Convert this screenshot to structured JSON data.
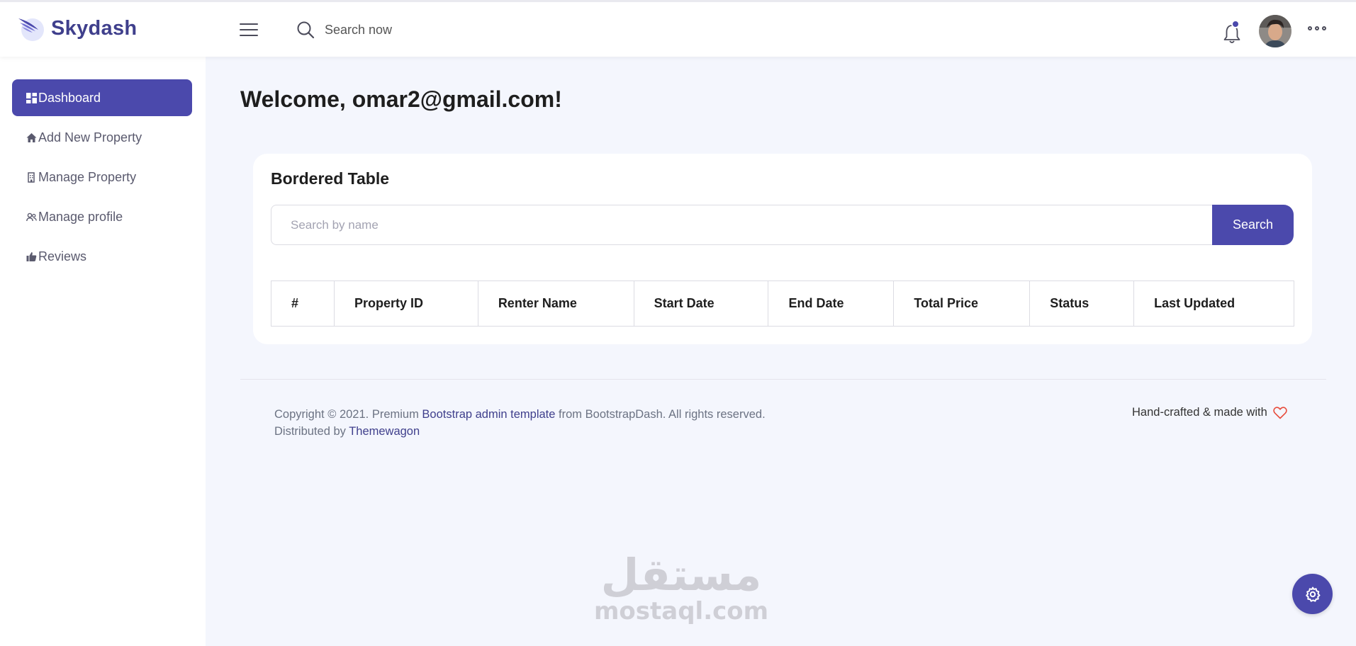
{
  "brand": {
    "name": "Skydash"
  },
  "header": {
    "search_placeholder": "Search now",
    "icons": [
      "menu-icon",
      "search-icon",
      "bell-icon",
      "avatar",
      "more-icon"
    ],
    "notification_dot_color": "#4b49ac"
  },
  "sidebar": {
    "items": [
      {
        "label": "Dashboard",
        "icon": "dashboard-icon",
        "active": true
      },
      {
        "label": "Add New Property",
        "icon": "home-icon",
        "active": false
      },
      {
        "label": "Manage Property",
        "icon": "building-icon",
        "active": false
      },
      {
        "label": "Manage profile",
        "icon": "users-icon",
        "active": false
      },
      {
        "label": "Reviews",
        "icon": "thumbs-up-icon",
        "active": false
      }
    ]
  },
  "main": {
    "welcome": "Welcome, omar2@gmail.com!",
    "card": {
      "title": "Bordered Table",
      "search_placeholder": "Search by name",
      "search_button": "Search",
      "columns": [
        "#",
        "Property ID",
        "Renter Name",
        "Start Date",
        "End Date",
        "Total Price",
        "Status",
        "Last Updated"
      ]
    }
  },
  "footer": {
    "copyright_prefix": "Copyright © 2021. Premium",
    "template_link": "Bootstrap admin template",
    "copyright_suffix": "from BootstrapDash. All rights reserved.",
    "distributed_prefix": "Distributed by",
    "distributed_link": "Themewagon",
    "crafted": "Hand-crafted & made with",
    "heart_icon": "heart-icon"
  },
  "watermark": {
    "arabic": "مستقل",
    "latin": "mostaql.com"
  },
  "colors": {
    "accent": "#4b49ac",
    "background": "#f4f6fd",
    "heart": "#e74c3c"
  }
}
